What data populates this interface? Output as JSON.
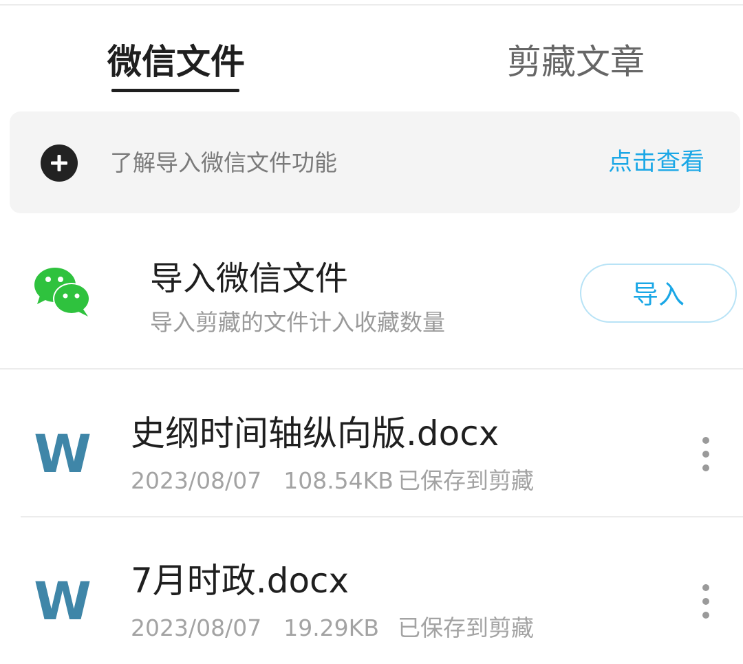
{
  "tabs": [
    {
      "label": "微信文件",
      "active": true
    },
    {
      "label": "剪藏文章",
      "active": false
    }
  ],
  "banner": {
    "text": "了解导入微信文件功能",
    "link": "点击查看",
    "icon": "plus-circle-icon"
  },
  "import": {
    "title": "导入微信文件",
    "subtitle": "导入剪藏的文件计入收藏数量",
    "button_label": "导入",
    "icon": "wechat-icon"
  },
  "files": [
    {
      "name": "史纲时间轴纵向版.docx",
      "date": "2023/08/07",
      "size": "108.54KB",
      "status": "已保存到剪藏",
      "icon": "word-doc-icon"
    },
    {
      "name": "7月时政.docx",
      "date": "2023/08/07",
      "size": "19.29KB",
      "status": "已保存到剪藏",
      "icon": "word-doc-icon"
    }
  ],
  "colors": {
    "accent": "#1aa7e6",
    "wechat_green": "#2fc23e",
    "word_blue": "#3f86a8",
    "text_primary": "#1f1f1f",
    "text_secondary": "#9a9a9a"
  }
}
